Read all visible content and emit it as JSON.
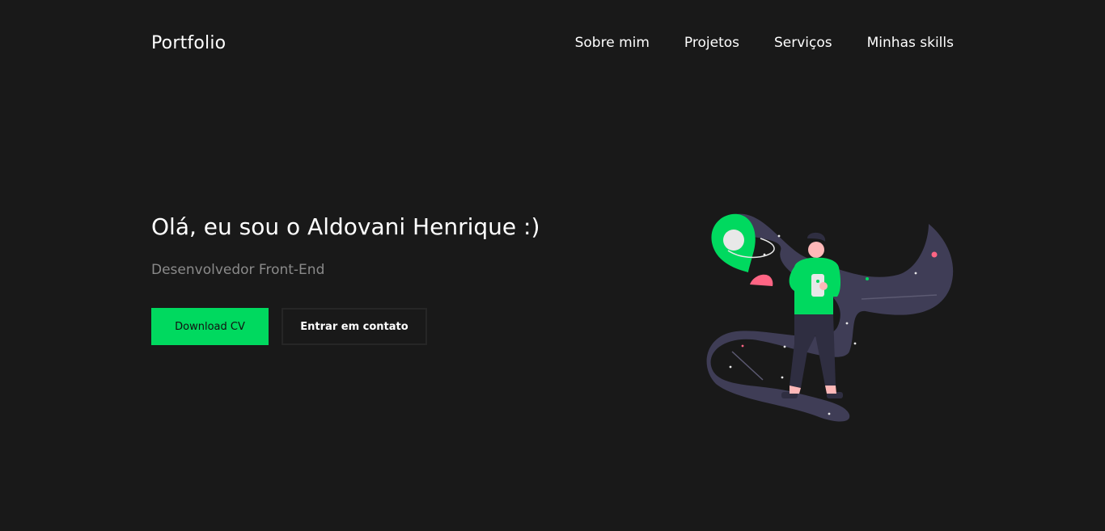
{
  "header": {
    "logo": "Portfolio",
    "nav": [
      {
        "label": "Sobre mim"
      },
      {
        "label": "Projetos"
      },
      {
        "label": "Serviços"
      },
      {
        "label": "Minhas skills"
      }
    ]
  },
  "hero": {
    "title": "Olá, eu sou o Aldovani Henrique :)",
    "subtitle": "Desenvolvedor Front-End",
    "primary_button": "Download CV",
    "secondary_button": "Entrar em contato"
  },
  "colors": {
    "background": "#191919",
    "accent": "#00d95f",
    "muted_text": "#8a8a8a",
    "illustration_path": "#3f3d56",
    "planet_pink": "#ff6584"
  },
  "illustration": {
    "icon": "astronaut-space-illustration"
  }
}
